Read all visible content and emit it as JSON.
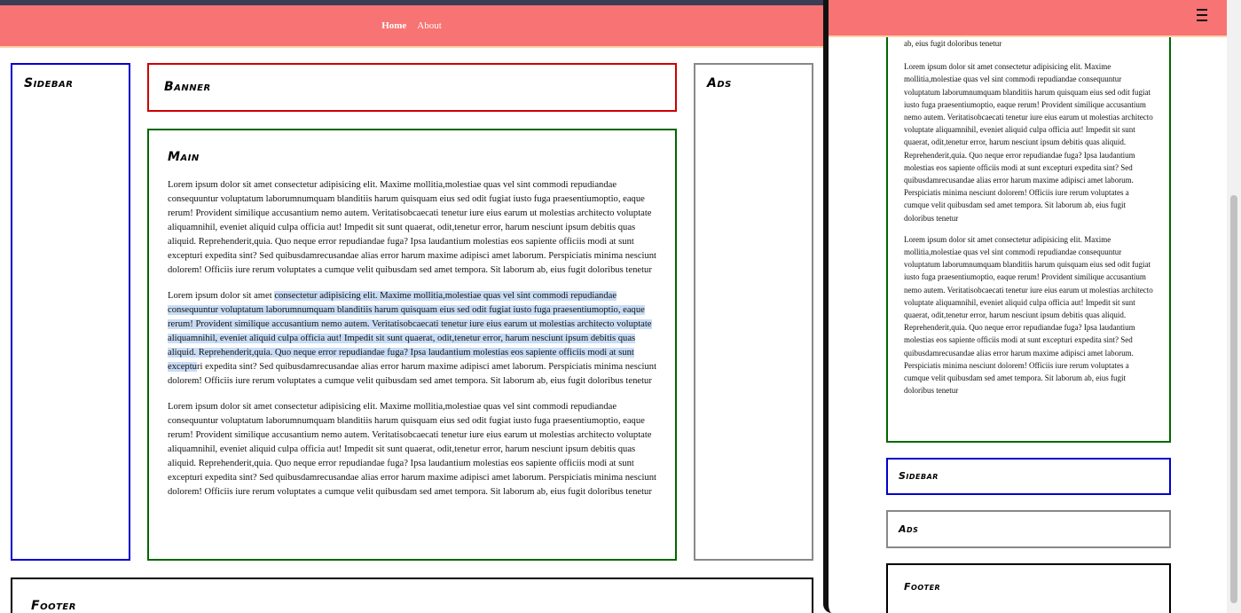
{
  "nav": {
    "home": "Home",
    "about": "About"
  },
  "headings": {
    "sidebar": "Sidebar",
    "banner": "Banner",
    "ads": "Ads",
    "main": "Main",
    "footer": "Footer"
  },
  "main": {
    "paragraph1": "Lorem ipsum dolor sit amet consectetur adipisicing elit. Maxime mollitia,molestiae quas vel sint commodi repudiandae consequuntur voluptatum laborumnumquam blanditiis harum quisquam eius sed odit fugiat iusto fuga praesentiumoptio, eaque rerum! Provident similique accusantium nemo autem. Veritatisobcaecati tenetur iure eius earum ut molestias architecto voluptate aliquamnihil, eveniet aliquid culpa officia aut! Impedit sit sunt quaerat, odit,tenetur error, harum nesciunt ipsum debitis quas aliquid. Reprehenderit,quia. Quo neque error repudiandae fuga? Ipsa laudantium molestias eos sapiente officiis modi at sunt excepturi expedita sint? Sed quibusdamrecusandae alias error harum maxime adipisci amet laborum. Perspiciatis minima nesciunt dolorem! Officiis iure rerum voluptates a cumque velit quibusdam sed amet tempora. Sit laborum ab, eius fugit doloribus tenetur",
    "paragraph2_before": "Lorem ipsum dolor sit amet ",
    "paragraph2_selected": "consectetur adipisicing elit. Maxime mollitia,molestiae quas vel sint commodi repudiandae consequuntur voluptatum laborumnumquam blanditiis harum quisquam eius sed odit fugiat iusto fuga praesentiumoptio, eaque rerum! Provident similique accusantium nemo autem. Veritatisobcaecati tenetur iure eius earum ut molestias architecto voluptate aliquamnihil, eveniet aliquid culpa officia aut! Impedit sit sunt quaerat, odit,tenetur error, harum nesciunt ipsum debitis quas aliquid. Reprehenderit,quia. Quo neque error repudiandae fuga? Ipsa laudantium molestias eos sapiente officiis modi at sunt exceptu",
    "paragraph2_after": "ri expedita sint? Sed quibusdamrecusandae alias error harum maxime adipisci amet laborum. Perspiciatis minima nesciunt dolorem! Officiis iure rerum voluptates a cumque velit quibusdam sed amet tempora. Sit laborum ab, eius fugit doloribus tenetur",
    "paragraph3": "Lorem ipsum dolor sit amet consectetur adipisicing elit. Maxime mollitia,molestiae quas vel sint commodi repudiandae consequuntur voluptatum laborumnumquam blanditiis harum quisquam eius sed odit fugiat iusto fuga praesentiumoptio, eaque rerum! Provident similique accusantium nemo autem. Veritatisobcaecati tenetur iure eius earum ut molestias architecto voluptate aliquamnihil, eveniet aliquid culpa officia aut! Impedit sit sunt quaerat, odit,tenetur error, harum nesciunt ipsum debitis quas aliquid. Reprehenderit,quia. Quo neque error repudiandae fuga? Ipsa laudantium molestias eos sapiente officiis modi at sunt excepturi expedita sint? Sed quibusdamrecusandae alias error harum maxime adipisci amet laborum. Perspiciatis minima nesciunt dolorem! Officiis iure rerum voluptates a cumque velit quibusdam sed amet tempora. Sit laborum ab, eius fugit doloribus tenetur"
  },
  "mobile": {
    "paragraph_top_tail": "ab, eius fugit doloribus tenetur",
    "paragraph_a": "Lorem ipsum dolor sit amet consectetur adipisicing elit. Maxime mollitia,molestiae quas vel sint commodi repudiandae consequuntur voluptatum laborumnumquam blanditiis harum quisquam eius sed odit fugiat iusto fuga praesentiumoptio, eaque rerum! Provident similique accusantium nemo autem. Veritatisobcaecati tenetur iure eius earum ut molestias architecto voluptate aliquamnihil, eveniet aliquid culpa officia aut! Impedit sit sunt quaerat, odit,tenetur error, harum nesciunt ipsum debitis quas aliquid. Reprehenderit,quia. Quo neque error repudiandae fuga? Ipsa laudantium molestias eos sapiente officiis modi at sunt excepturi expedita sint? Sed quibusdamrecusandae alias error harum maxime adipisci amet laborum. Perspiciatis minima nesciunt dolorem! Officiis iure rerum voluptates a cumque velit quibusdam sed amet tempora. Sit laborum ab, eius fugit doloribus tenetur",
    "paragraph_b": "Lorem ipsum dolor sit amet consectetur adipisicing elit. Maxime mollitia,molestiae quas vel sint commodi repudiandae consequuntur voluptatum laborumnumquam blanditiis harum quisquam eius sed odit fugiat iusto fuga praesentiumoptio, eaque rerum! Provident similique accusantium nemo autem. Veritatisobcaecati tenetur iure eius earum ut molestias architecto voluptate aliquamnihil, eveniet aliquid culpa officia aut! Impedit sit sunt quaerat, odit,tenetur error, harum nesciunt ipsum debitis quas aliquid. Reprehenderit,quia. Quo neque error repudiandae fuga? Ipsa laudantium molestias eos sapiente officiis modi at sunt excepturi expedita sint? Sed quibusdamrecusandae alias error harum maxime adipisci amet laborum. Perspiciatis minima nesciunt dolorem! Officiis iure rerum voluptates a cumque velit quibusdam sed amet tempora. Sit laborum ab, eius fugit doloribus tenetur",
    "menu_icon": "hamburger-icon"
  },
  "colors": {
    "nav_bg": "#f87373",
    "sidebar_border": "#0000cc",
    "banner_border": "#cc0000",
    "main_border": "#006600",
    "ads_border": "#888888",
    "footer_border": "#000000",
    "selection": "#c8dcf5"
  }
}
